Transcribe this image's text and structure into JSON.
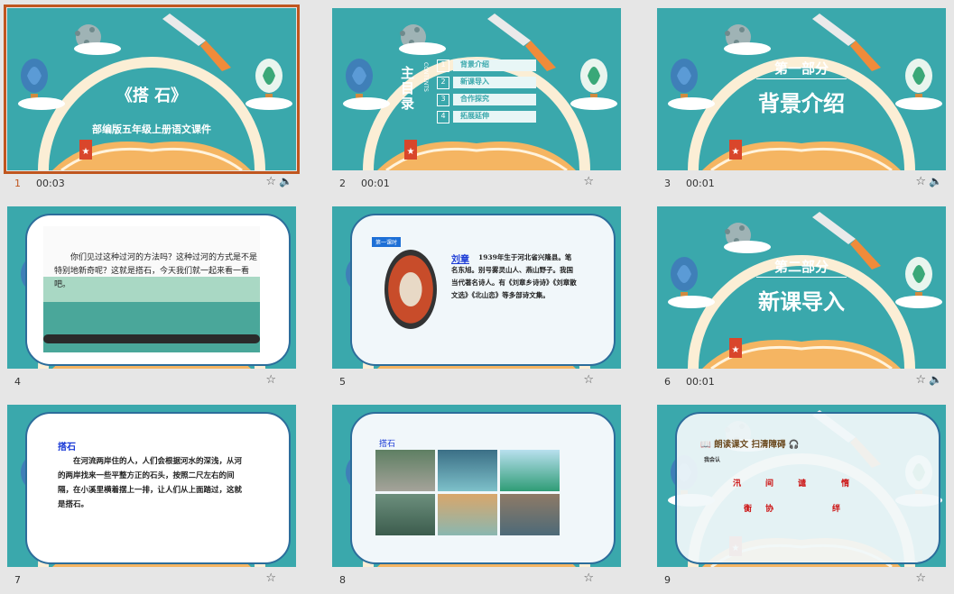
{
  "slides": [
    {
      "num": "1",
      "time": "00:03",
      "title": "《搭 石》",
      "subtitle": "部编版五年级上册语文课件"
    },
    {
      "num": "2",
      "time": "00:01",
      "toc_title": "主目录",
      "toc_en": "CONTENTS",
      "items": [
        {
          "n": "1",
          "t": "背景介绍"
        },
        {
          "n": "2",
          "t": "新课导入"
        },
        {
          "n": "3",
          "t": "合作探究"
        },
        {
          "n": "4",
          "t": "拓展延伸"
        }
      ]
    },
    {
      "num": "3",
      "time": "00:01",
      "part": "第一部分",
      "heading": "背景介绍"
    },
    {
      "num": "4",
      "time": "",
      "text": "你们见过这种过河的方法吗？这种过河的方式是不是特别地新奇呢？这就是搭石，今天我们就一起来看一看吧。"
    },
    {
      "num": "5",
      "time": "",
      "tag": "第一课时",
      "name": "刘章",
      "bio": "1939年生于河北省兴隆县。笔名东旭。别号雾灵山人、燕山野子。我国当代著名诗人。有《刘章乡诗诗》《刘章散文选》《北山恋》等多部诗文集。"
    },
    {
      "num": "6",
      "time": "00:01",
      "part": "第二部分",
      "heading": "新课导入"
    },
    {
      "num": "7",
      "time": "",
      "title": "搭石",
      "text": "在河流两岸住的人，人们会根据河水的深浅，从河的两岸找来一些平整方正的石头，按照二尺左右的间隔，在小溪里横着摆上一排，让人们从上面踏过，这就是搭石。"
    },
    {
      "num": "8",
      "time": "",
      "title": "搭石"
    },
    {
      "num": "9",
      "time": "",
      "title": "朗读课文 扫清障碍",
      "sub": "我会认",
      "chars": [
        "汛",
        "间",
        "谴",
        "惰",
        "衡",
        "协",
        "绊"
      ]
    }
  ],
  "colors": {
    "teal": "#3aa8ac",
    "accent": "#c0561f",
    "book": "#f5b562"
  },
  "icons": {
    "star": "star-icon",
    "speaker": "speaker-icon"
  }
}
